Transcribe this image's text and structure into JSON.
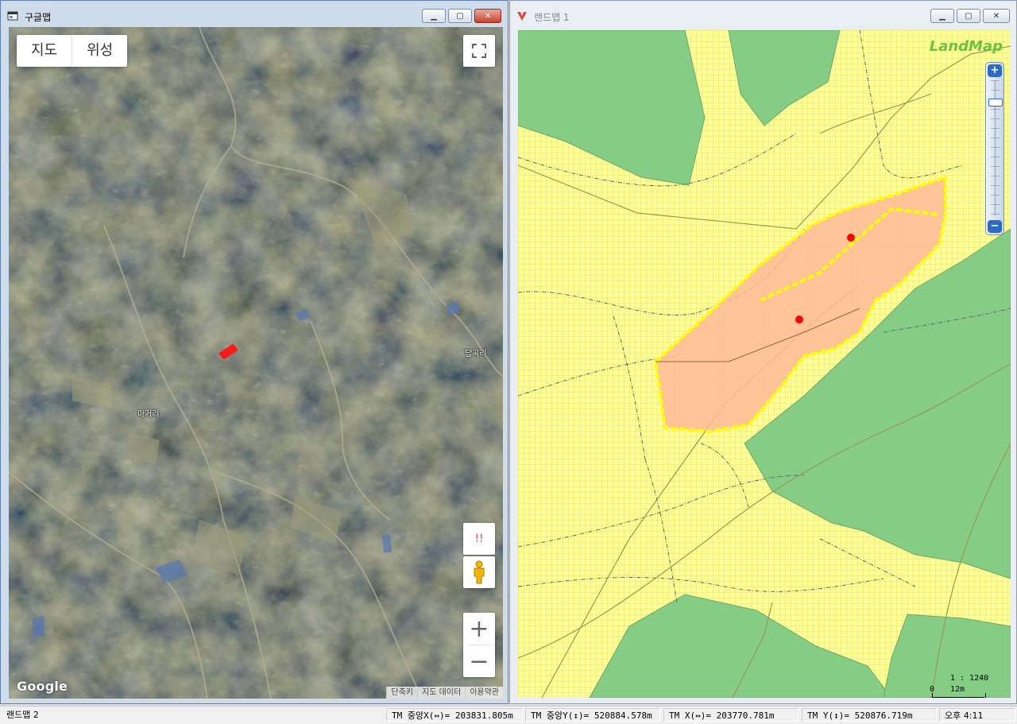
{
  "google_window": {
    "title": "구글맵",
    "map_type": {
      "map_label": "지도",
      "satellite_label": "위성"
    },
    "place_labels": {
      "dapgokri": "답곡리",
      "mageori": "마거리"
    },
    "google_logo": "Google",
    "report_label": "!!",
    "attribution": {
      "shortcuts": "단축키",
      "map_data": "지도 데이터",
      "terms": "이용약관"
    },
    "icons": {
      "fullscreen": "fullscreen-icon",
      "pegman": "pegman-icon",
      "zoom_in": "plus-icon",
      "zoom_out": "minus-icon"
    }
  },
  "landmap_window": {
    "title": "랜드맵 1",
    "logo": "LandMap",
    "scale_ratio": "1 : 1240",
    "scale_start": "0",
    "scale_length": "12m",
    "colors": {
      "parcel_grid": "#ffff99",
      "forest": "#85cc85",
      "selected_parcel": "#ffbb99",
      "parcel_outline": "#ffff00",
      "marker": "#ff0000"
    }
  },
  "status_bar": {
    "app_label": "랜드맵 2",
    "tm_center_x": "TM 중앙X(↔)= 203831.805m",
    "tm_center_y": "TM 중앙Y(↕)= 520884.578m",
    "tm_x": "TM X(↔)= 203770.781m",
    "tm_y": "TM Y(↕)= 520876.719m",
    "clock": "오후 4:11"
  }
}
